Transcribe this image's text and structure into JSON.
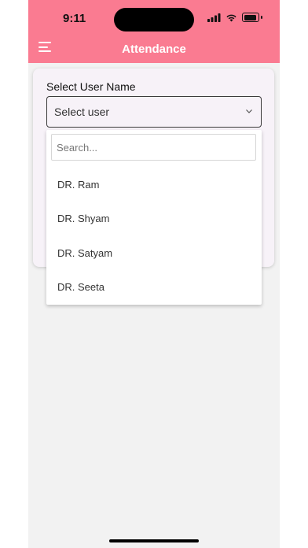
{
  "status_bar": {
    "time": "9:11"
  },
  "header": {
    "title": "Attendance",
    "menu_icon": "hamburger-menu-icon"
  },
  "form": {
    "label": "Select User Name",
    "select": {
      "value": "Select user",
      "icon": "chevron-down-icon"
    }
  },
  "dropdown": {
    "search_placeholder": "Search...",
    "options": [
      {
        "label": "DR. Ram"
      },
      {
        "label": "DR. Shyam"
      },
      {
        "label": "DR. Satyam"
      },
      {
        "label": "DR. Seeta"
      }
    ]
  },
  "colors": {
    "header": "#fa7b91",
    "background": "#f2f2f2",
    "card": "#f7f2f8"
  }
}
